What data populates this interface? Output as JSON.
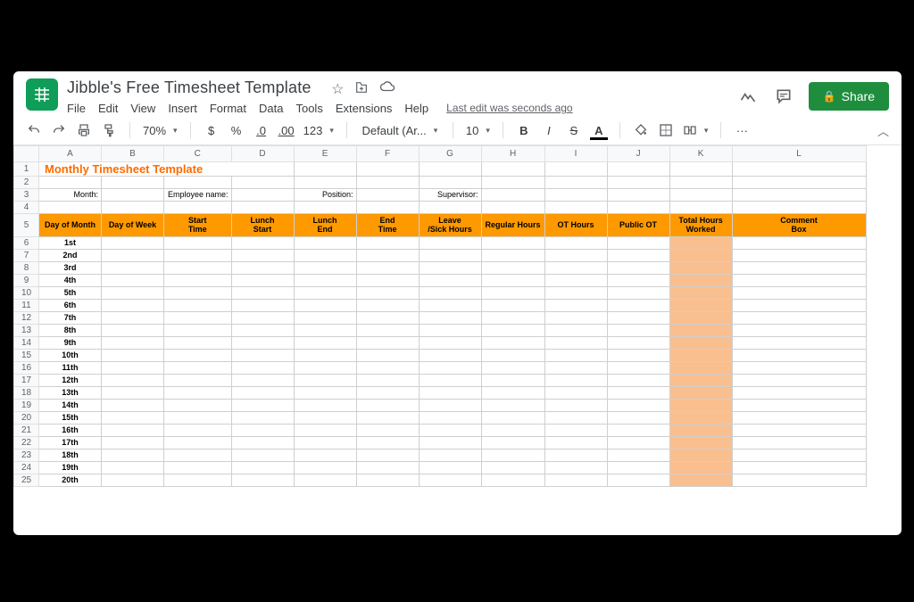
{
  "doc": {
    "title": "Jibble's Free Timesheet Template",
    "last_edit": "Last edit was seconds ago"
  },
  "menu": [
    "File",
    "Edit",
    "View",
    "Insert",
    "Format",
    "Data",
    "Tools",
    "Extensions",
    "Help"
  ],
  "share": "Share",
  "toolbar": {
    "zoom": "70%",
    "currency": "$",
    "percent": "%",
    "dec_dec": ".0",
    "dec_inc": ".00",
    "num_fmt": "123",
    "font": "Default (Ar...",
    "size": "10",
    "more": "···",
    "bold": "B",
    "italic": "I",
    "strike": "S",
    "textcolor": "A"
  },
  "columns": [
    "A",
    "B",
    "C",
    "D",
    "E",
    "F",
    "G",
    "H",
    "I",
    "J",
    "K",
    "L"
  ],
  "sheet_title": "Monthly Timesheet Template",
  "labels": {
    "month": "Month:",
    "employee": "Employee name:",
    "position": "Position:",
    "supervisor": "Supervisor:"
  },
  "headers": [
    "Day of Month",
    "Day of Week",
    "Start\nTime",
    "Lunch\nStart",
    "Lunch\nEnd",
    "End\nTime",
    "Leave\n/Sick Hours",
    "Regular Hours",
    "OT Hours",
    "Public OT",
    "Total Hours\nWorked",
    "Comment\nBox"
  ],
  "days": [
    "1st",
    "2nd",
    "3rd",
    "4th",
    "5th",
    "6th",
    "7th",
    "8th",
    "9th",
    "10th",
    "11th",
    "12th",
    "13th",
    "14th",
    "15th",
    "16th",
    "17th",
    "18th",
    "19th",
    "20th"
  ]
}
